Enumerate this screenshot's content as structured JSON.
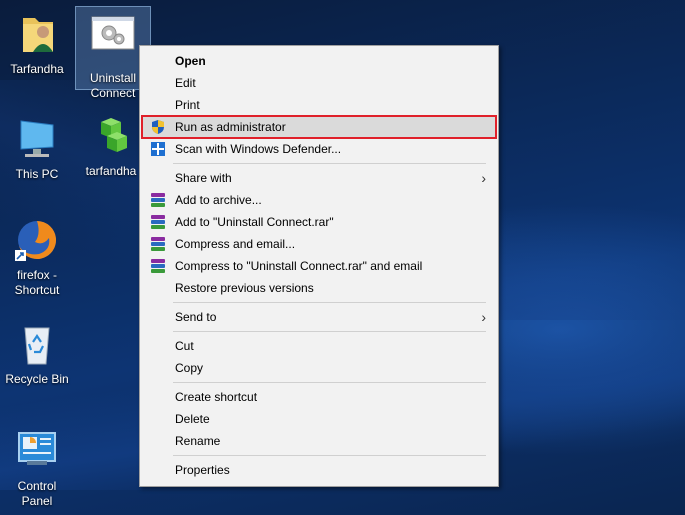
{
  "desktop": {
    "icons": [
      {
        "label": "Tarfandha"
      },
      {
        "label": "Uninstall Connect"
      },
      {
        "label": "This PC"
      },
      {
        "label": "tarfandha"
      },
      {
        "label": "firefox - Shortcut"
      },
      {
        "label": "Recycle Bin"
      },
      {
        "label": "Control Panel"
      }
    ]
  },
  "context_menu": {
    "items": [
      {
        "label": "Open",
        "icon": "none"
      },
      {
        "label": "Edit",
        "icon": "none"
      },
      {
        "label": "Print",
        "icon": "none"
      },
      {
        "label": "Run as administrator",
        "icon": "uac-shield-icon",
        "highlighted": true
      },
      {
        "label": "Scan with Windows Defender...",
        "icon": "windows-defender-icon"
      },
      {
        "label": "Share with",
        "icon": "none",
        "submenu": true
      },
      {
        "label": "Add to archive...",
        "icon": "winrar-icon"
      },
      {
        "label": "Add to \"Uninstall Connect.rar\"",
        "icon": "winrar-icon"
      },
      {
        "label": "Compress and email...",
        "icon": "winrar-icon"
      },
      {
        "label": "Compress to \"Uninstall Connect.rar\" and email",
        "icon": "winrar-icon"
      },
      {
        "label": "Restore previous versions",
        "icon": "none"
      },
      {
        "label": "Send to",
        "icon": "none",
        "submenu": true
      },
      {
        "label": "Cut",
        "icon": "none"
      },
      {
        "label": "Copy",
        "icon": "none"
      },
      {
        "label": "Create shortcut",
        "icon": "none"
      },
      {
        "label": "Delete",
        "icon": "none"
      },
      {
        "label": "Rename",
        "icon": "none"
      },
      {
        "label": "Properties",
        "icon": "none"
      }
    ],
    "submenu_arrow": "›"
  },
  "colors": {
    "highlight_border": "#e0202a",
    "desktop_bg": "#0b2a5c",
    "menu_bg": "#f2f2f2"
  }
}
